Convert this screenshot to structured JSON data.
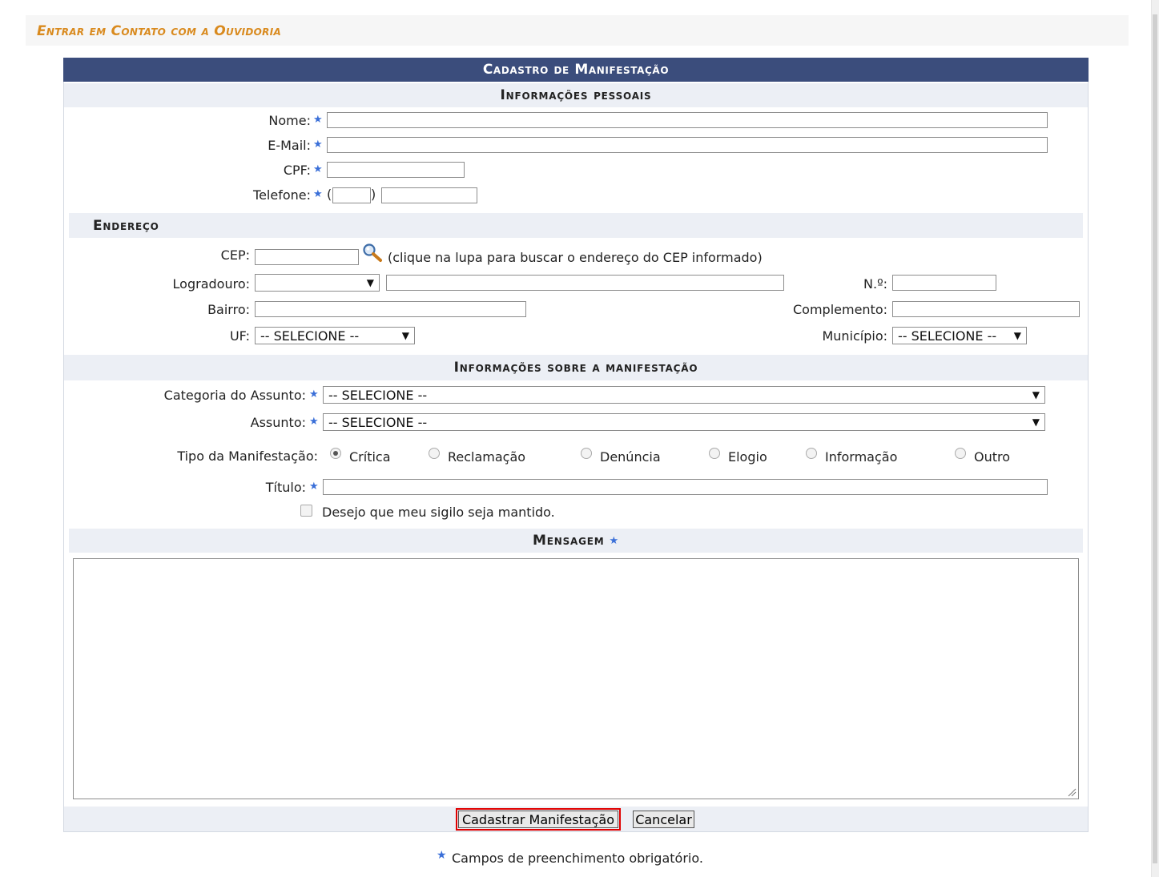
{
  "page": {
    "title": "Entrar em Contato com a Ouvidoria"
  },
  "form": {
    "caption": "Cadastro de Manifestação",
    "personal": {
      "section_title": "Informações pessoais",
      "name_label": "Nome:",
      "email_label": "E-Mail:",
      "cpf_label": "CPF:",
      "phone_label": "Telefone:"
    },
    "address": {
      "section_title": "Endereço",
      "cep_label": "CEP:",
      "cep_hint": "(clique na lupa para buscar o endereço do CEP informado)",
      "street_label": "Logradouro:",
      "number_label": "N.º:",
      "district_label": "Bairro:",
      "complement_label": "Complemento:",
      "uf_label": "UF:",
      "uf_value": "-- SELECIONE --",
      "city_label": "Município:",
      "city_value": "-- SELECIONE --"
    },
    "manifestation": {
      "section_title": "Informações sobre a manifestação",
      "category_label": "Categoria do Assunto:",
      "category_value": "-- SELECIONE --",
      "subject_label": "Assunto:",
      "subject_value": "-- SELECIONE --",
      "type_label": "Tipo da Manifestação:",
      "types": [
        "Crítica",
        "Reclamação",
        "Denúncia",
        "Elogio",
        "Informação",
        "Outro"
      ],
      "selected_type": "Crítica",
      "title_label": "Título:",
      "secrecy_label": "Desejo que meu sigilo seja mantido."
    },
    "message": {
      "section_title": "Mensagem"
    },
    "buttons": {
      "submit": "Cadastrar Manifestação",
      "cancel": "Cancelar"
    },
    "footer_note": "Campos de preenchimento obrigatório."
  },
  "colors": {
    "header_bg": "#3b4d7c",
    "subheader_bg": "#eceff5",
    "title_orange": "#d98a1e",
    "required_star": "#3a6fd8",
    "submit_highlight": "#e00000"
  }
}
